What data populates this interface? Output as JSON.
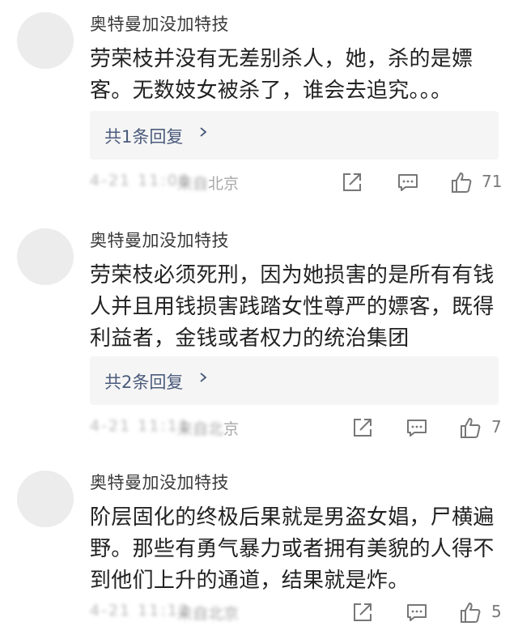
{
  "comments": [
    {
      "username": "奥特曼加没加特技",
      "content": "劳荣枝并没有无差别杀人，她，杀的是嫖客。无数妓女被杀了，谁会去追究。。。",
      "replies_label": "共1条回复",
      "time_blurred": "4-21 11:08",
      "location_blurred": "来自",
      "location_visible": "北京",
      "likes": "71"
    },
    {
      "username": "奥特曼加没加特技",
      "content": "劳荣枝必须死刑，因为她损害的是所有有钱人并且用钱损害践踏女性尊严的嫖客，既得利益者，金钱或者权力的统治集团",
      "replies_label": "共2条回复",
      "time_blurred": "4-21 11:11",
      "location_blurred": "来自北",
      "location_visible": "京",
      "likes": "7"
    },
    {
      "username": "奥特曼加没加特技",
      "content": "阶层固化的终极后果就是男盗女娼，尸横遍野。那些有勇气暴力或者拥有美貌的人得不到他们上升的通道，结果就是炸。",
      "replies_label": null,
      "time_blurred": "4-21 11:12",
      "location_blurred": "来自北京",
      "location_visible": "",
      "likes": "5"
    }
  ],
  "icons": {
    "share": "share-icon",
    "comment": "comment-icon",
    "like": "thumbs-up-icon",
    "chevron": "chevron-right-icon"
  },
  "colors": {
    "reply_link": "#4a5b7c",
    "reply_bg": "#f5f5f5",
    "avatar": "#ececec",
    "meta": "#a8a8a8"
  }
}
